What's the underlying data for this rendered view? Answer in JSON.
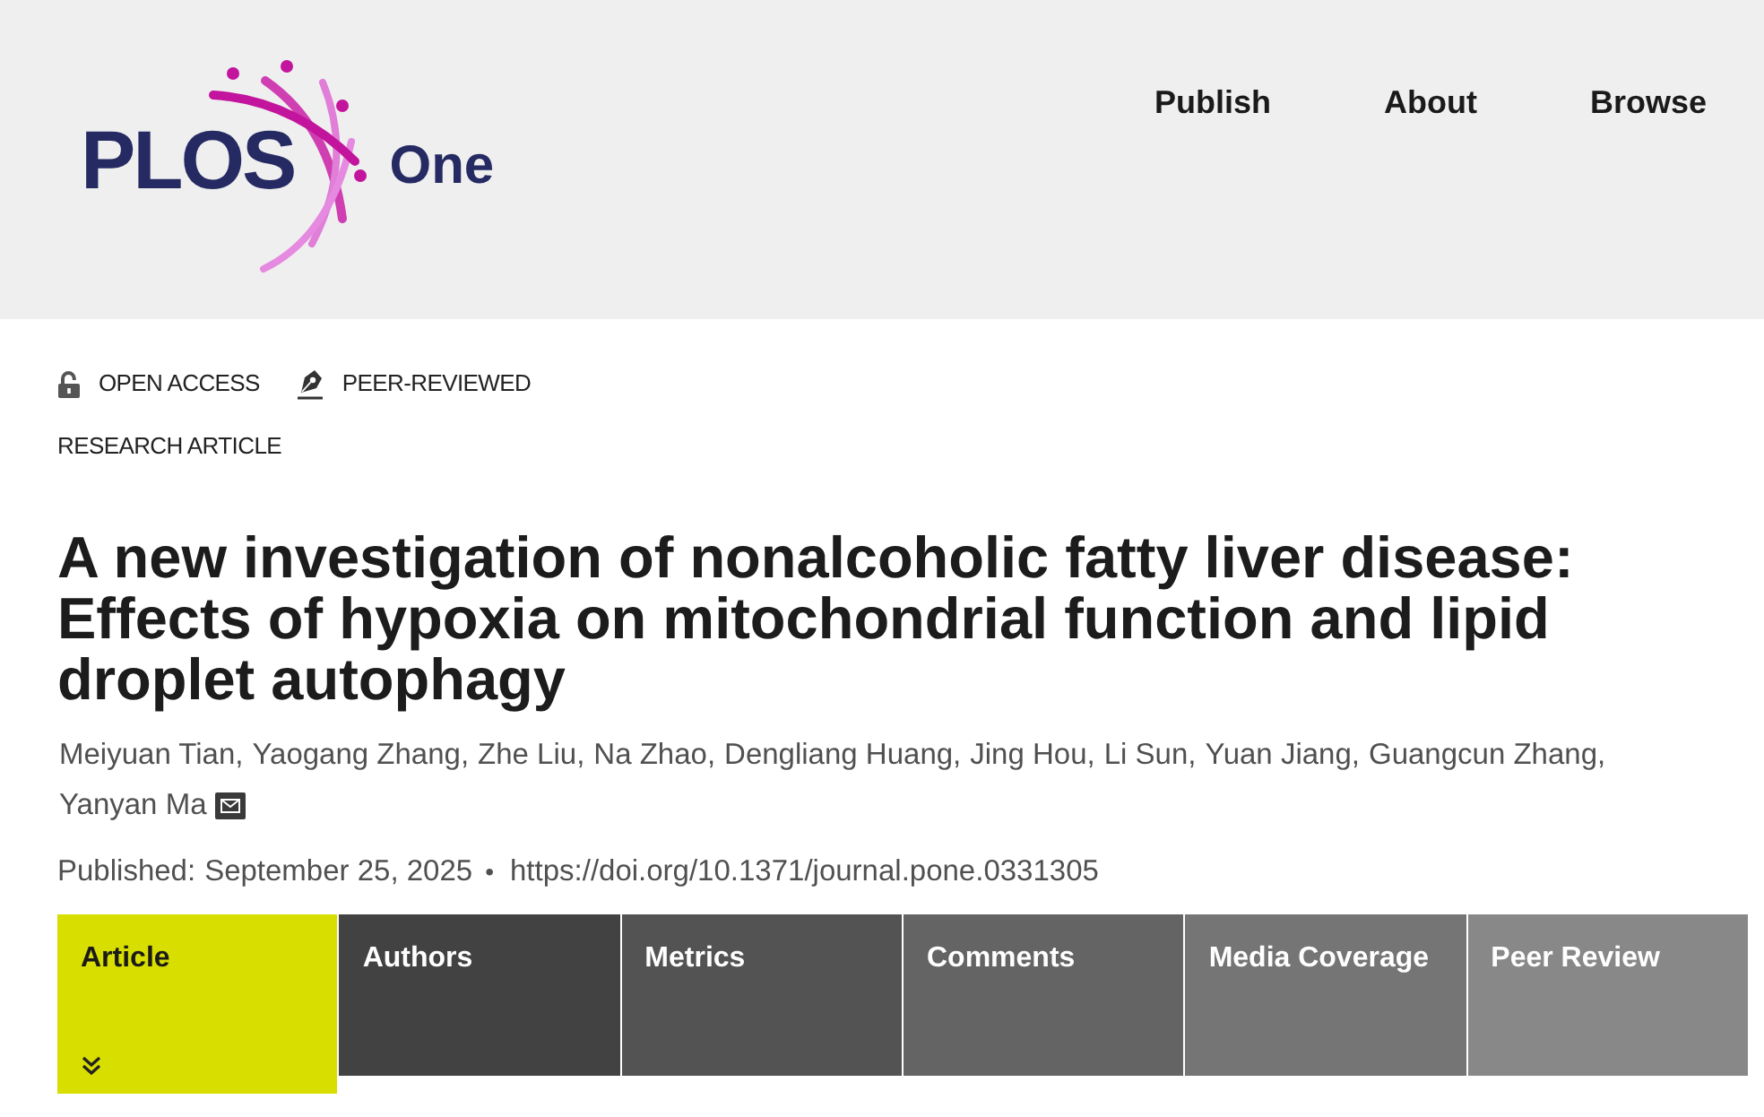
{
  "header": {
    "logo": {
      "wordmark": "PLOS",
      "journal": "One"
    },
    "nav": [
      {
        "label": "Publish"
      },
      {
        "label": "About"
      },
      {
        "label": "Browse"
      }
    ]
  },
  "badges": [
    {
      "kind": "open-access",
      "label": "OPEN ACCESS"
    },
    {
      "kind": "peer-reviewed",
      "label": "PEER-REVIEWED"
    }
  ],
  "article_type": "RESEARCH ARTICLE",
  "title": "A new investigation of nonalcoholic fatty liver disease: Effects of hypoxia on mitochondrial function and lipid droplet autophagy",
  "authors": [
    {
      "name": "Meiyuan Tian,",
      "corresponding": false
    },
    {
      "name": "Yaogang Zhang,",
      "corresponding": false
    },
    {
      "name": "Zhe Liu,",
      "corresponding": false
    },
    {
      "name": "Na Zhao,",
      "corresponding": false
    },
    {
      "name": "Dengliang Huang,",
      "corresponding": false
    },
    {
      "name": "Jing Hou,",
      "corresponding": false
    },
    {
      "name": "Li Sun,",
      "corresponding": false
    },
    {
      "name": "Yuan Jiang,",
      "corresponding": false
    },
    {
      "name": "Guangcun Zhang,",
      "corresponding": false
    },
    {
      "name": "Yanyan Ma",
      "corresponding": true
    }
  ],
  "publication": {
    "label": "Published:",
    "date": "September 25, 2025",
    "separator": "•",
    "doi": "https://doi.org/10.1371/journal.pone.0331305"
  },
  "tabs": [
    {
      "label": "Article",
      "selected": true
    },
    {
      "label": "Authors",
      "selected": false
    },
    {
      "label": "Metrics",
      "selected": false
    },
    {
      "label": "Comments",
      "selected": false
    },
    {
      "label": "Media Coverage",
      "selected": false
    },
    {
      "label": "Peer Review",
      "selected": false
    }
  ]
}
